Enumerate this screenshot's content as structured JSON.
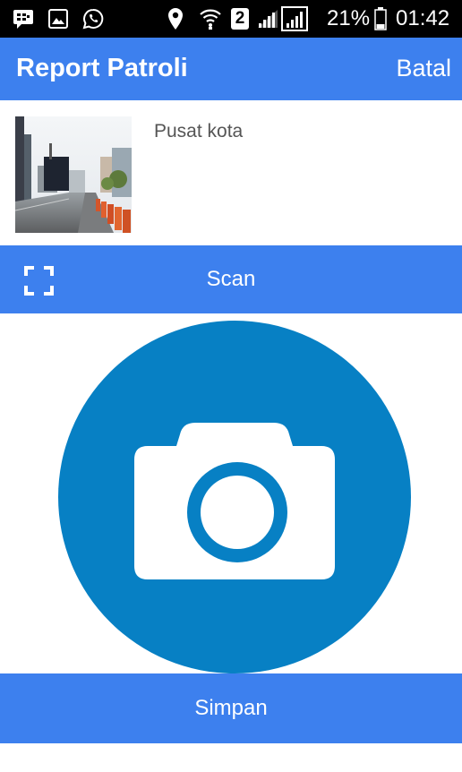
{
  "status_bar": {
    "icons": [
      "bbm-icon",
      "gallery-icon",
      "whatsapp-icon",
      "location-icon",
      "wifi-icon",
      "sim-2-icon",
      "signal-icon",
      "signal-icon",
      "battery-icon"
    ],
    "sim_label": "2",
    "battery_percent": "21%",
    "time": "01:42"
  },
  "app_bar": {
    "title": "Report Patroli",
    "cancel_label": "Batal",
    "color": "#3d80ee"
  },
  "location": {
    "name": "Pusat kota"
  },
  "scan_button": {
    "label": "Scan",
    "icon": "scan-frame-icon"
  },
  "camera": {
    "icon": "camera-icon",
    "circle_color": "#0780c4"
  },
  "save_button": {
    "label": "Simpan"
  }
}
